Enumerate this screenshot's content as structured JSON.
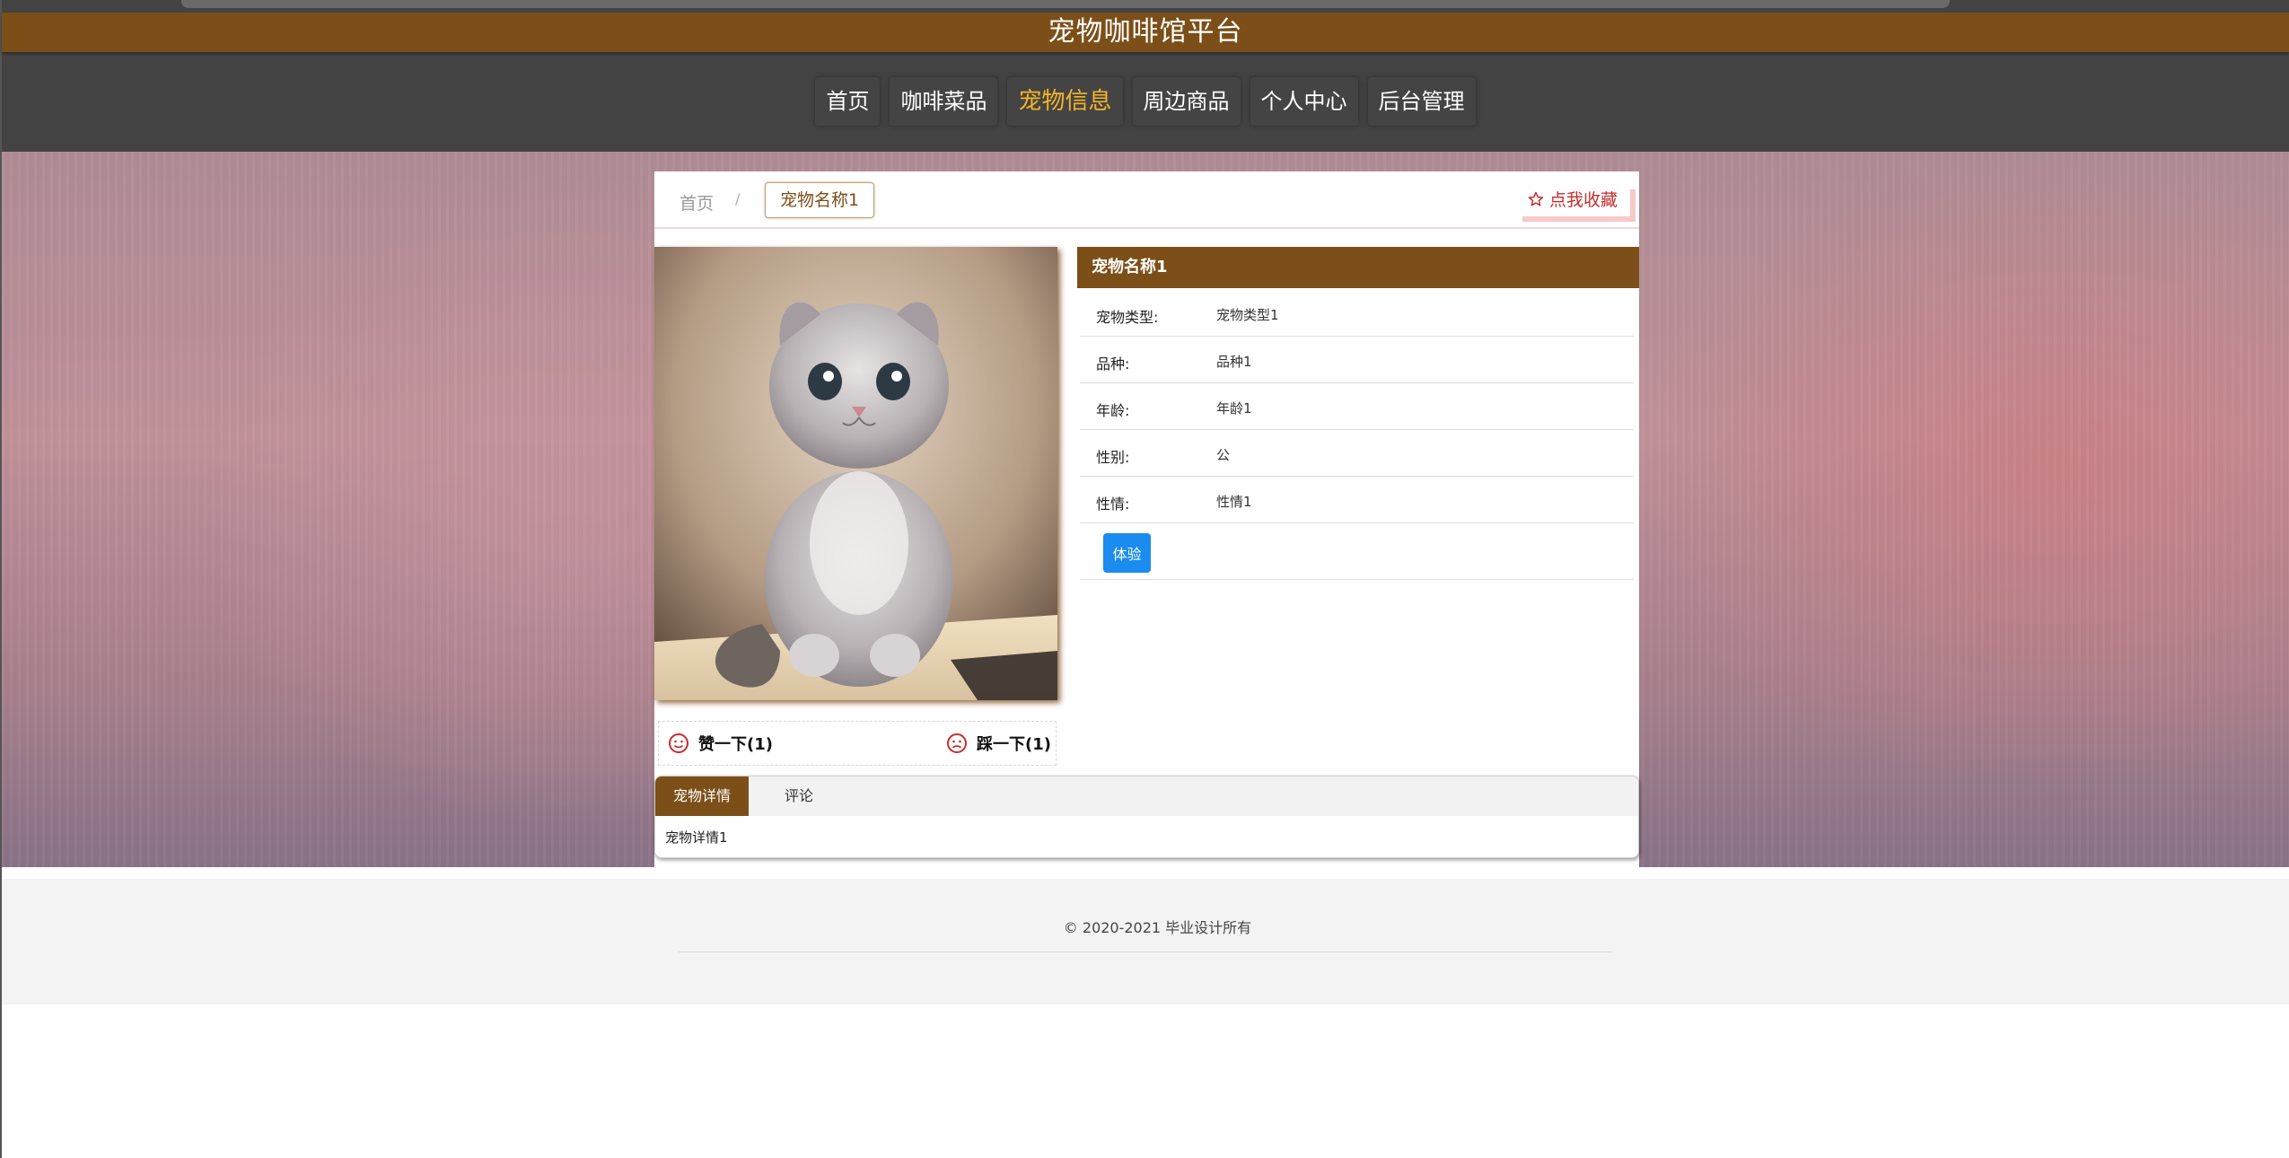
{
  "site": {
    "title": "宠物咖啡馆平台"
  },
  "nav": {
    "items": [
      {
        "label": "首页"
      },
      {
        "label": "咖啡菜品"
      },
      {
        "label": "宠物信息"
      },
      {
        "label": "周边商品"
      },
      {
        "label": "个人中心"
      },
      {
        "label": "后台管理"
      }
    ],
    "active": "宠物信息"
  },
  "breadcrumb": {
    "home": "首页",
    "separator": "/",
    "current": "宠物名称1"
  },
  "favorite": {
    "icon": "star-outline-icon",
    "label": "点我收藏"
  },
  "pet": {
    "name": "宠物名称1",
    "fields": [
      {
        "label": "宠物类型:",
        "value": "宠物类型1"
      },
      {
        "label": "品种:",
        "value": "品种1"
      },
      {
        "label": "年龄:",
        "value": "年龄1"
      },
      {
        "label": "性别:",
        "value": "公"
      },
      {
        "label": "性情:",
        "value": "性情1"
      }
    ],
    "experience_label": "体验"
  },
  "votes": {
    "like": {
      "icon": "smile-icon",
      "label": "赞一下(1)"
    },
    "dislike": {
      "icon": "frown-icon",
      "label": "踩一下(1)"
    }
  },
  "tabs": {
    "items": [
      {
        "label": "宠物详情"
      },
      {
        "label": "评论"
      }
    ],
    "active": "宠物详情",
    "content": "宠物详情1"
  },
  "footer": {
    "copyright": "© 2020-2021 毕业设计所有"
  },
  "colors": {
    "brand": "#7c4f18",
    "nav_bg": "#434343",
    "nav_active": "#f6b526",
    "button_blue": "#1a8cf0",
    "favorite_red": "#c62e2e"
  }
}
